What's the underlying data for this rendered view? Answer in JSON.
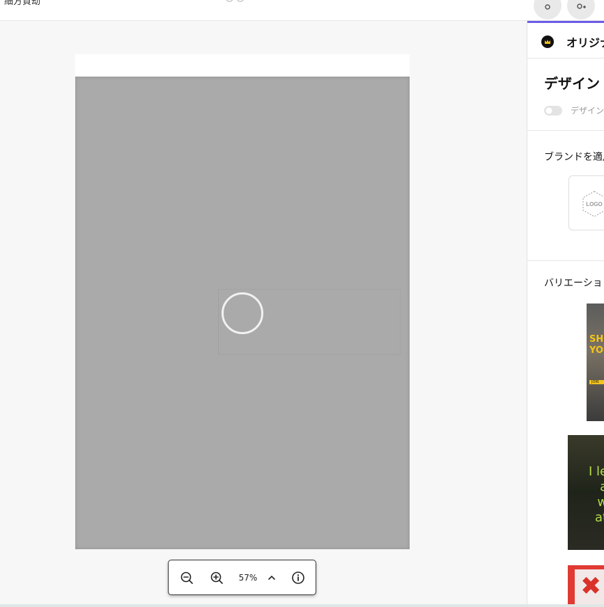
{
  "topbar": {
    "title_fragment": "細方賀劫",
    "undo_glyph": "↺↻"
  },
  "icons": {
    "undo": "undo-icon",
    "share": "share-icon",
    "add_user": "add-user-icon",
    "zoom_out": "zoom-out-icon",
    "zoom_in": "zoom-in-icon",
    "chevron_up": "chevron-up-icon",
    "info": "info-icon",
    "crown": "crown-icon",
    "spinner": "loading-spinner"
  },
  "zoom": {
    "level": "57%"
  },
  "panel": {
    "accent_color": "#6c5ce7",
    "premium_label": "オリジナル",
    "design_title": "デザイン",
    "toggle_label": "デザイン",
    "brand_title": "ブランドを適用",
    "logo_text": "LOGO",
    "variations_title": "バリエーション",
    "thumbnails": [
      {
        "text": "SHO\nYOU",
        "small": "JOIN"
      },
      {
        "text": "I le\na\nw\nat"
      },
      {
        "text": "✖"
      }
    ]
  }
}
